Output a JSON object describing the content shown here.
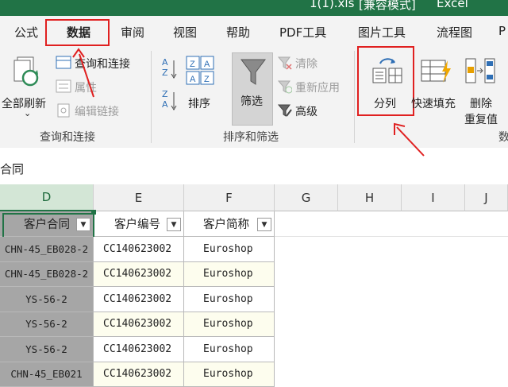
{
  "window": {
    "title": "1(1).xls [兼容模式] - Excel",
    "title_left": "1(1).xls",
    "title_mode": "[兼容模式]",
    "title_app": "Excel"
  },
  "tabs": [
    "公式",
    "数据",
    "审阅",
    "视图",
    "帮助",
    "PDF工具",
    "图片工具",
    "流程图",
    "P"
  ],
  "ribbon": {
    "refresh_all": "全部刷新",
    "refresh_arrow": "⌄",
    "queries_connections": "查询和连接",
    "properties": "属性",
    "edit_links": "编辑链接",
    "group_queries": "查询和连接",
    "sort": "排序",
    "filter": "筛选",
    "clear": "清除",
    "reapply": "重新应用",
    "advanced": "高级",
    "group_sort_filter": "排序和筛选",
    "split_columns": "分列",
    "flash_fill": "快速填充",
    "remove_duplicates_line1": "删除",
    "remove_duplicates_line2": "重复值",
    "group_data_tools": "数",
    "za_top": "Z",
    "za_bottom": "A",
    "az_top": "A",
    "az_bottom": "Z"
  },
  "formula_bar": {
    "content": "合同"
  },
  "grid": {
    "columns": [
      "D",
      "E",
      "F",
      "G",
      "H",
      "I",
      "J"
    ],
    "headers": [
      "客户合同",
      "客户编号",
      "客户简称"
    ],
    "filter_arrow": "▼",
    "rows": [
      [
        "CHN-45_EB028-2",
        "CC140623002",
        "Euroshop"
      ],
      [
        "CHN-45_EB028-2",
        "CC140623002",
        "Euroshop"
      ],
      [
        "YS-56-2",
        "CC140623002",
        "Euroshop"
      ],
      [
        "YS-56-2",
        "CC140623002",
        "Euroshop"
      ],
      [
        "YS-56-2",
        "CC140623002",
        "Euroshop"
      ],
      [
        "CHN-45_EB021",
        "CC140623002",
        "Euroshop"
      ]
    ]
  },
  "colors": {
    "excel_green": "#217346",
    "highlight_red": "#e02020",
    "selected_col_fill": "#a6a6a6",
    "alt_row": "#fdfdee"
  }
}
